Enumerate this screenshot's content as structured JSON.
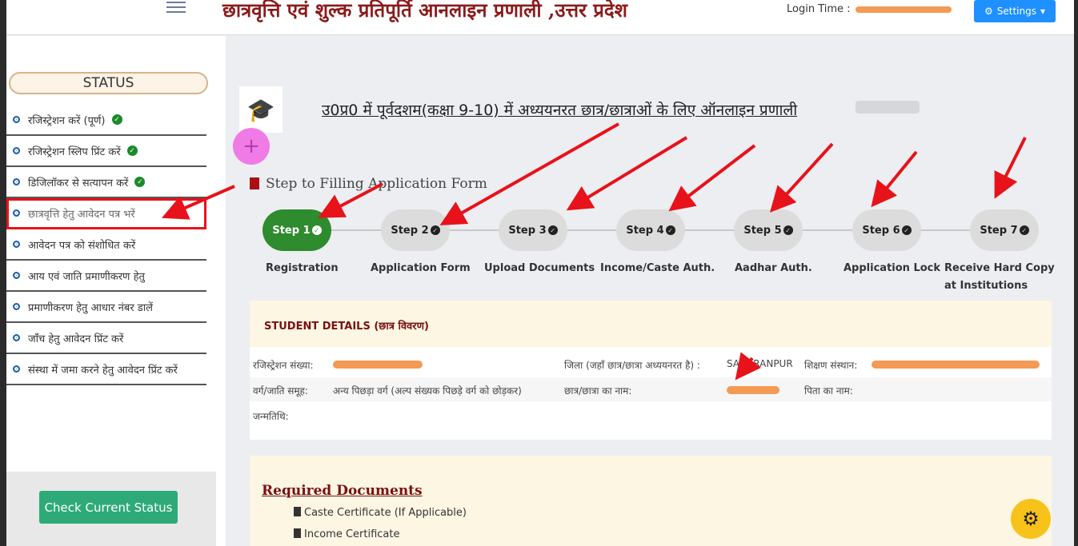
{
  "header": {
    "app_title": "छात्रवृत्ति एवं शुल्क प्रतिपूर्ति आनलाइन प्रणाली ,उत्तर प्रदेश",
    "login_label": "Login Time :",
    "settings_label": "Settings"
  },
  "sidebar": {
    "status_title": "STATUS",
    "items": [
      {
        "label": "रजिस्ट्रेशन करें (पूर्ण)",
        "done": true
      },
      {
        "label": "रजिस्ट्रेशन स्लिप प्रिंट करें",
        "done": true
      },
      {
        "label": "डिजिलॉकर से सत्यापन करें",
        "done": true
      },
      {
        "label": "छात्रवृत्ति हेतु आवेदन पत्र भरें",
        "done": false
      },
      {
        "label": "आवेदन पत्र को संशोधित करें",
        "done": false
      },
      {
        "label": "आय एवं जाति प्रमाणीकरण हेतु",
        "done": false
      },
      {
        "label": "प्रमाणीकरण हेतु आधार नंबर डालें",
        "done": false
      },
      {
        "label": "जाँच हेतु आवेदन प्रिंट करें",
        "done": false
      },
      {
        "label": "संस्था में जमा करने हेतु आवेदन प्रिंट करें",
        "done": false
      }
    ],
    "check_button": "Check Current Status"
  },
  "main": {
    "title": "उ0प्र0 में पूर्वदशम(कक्षा 9-10) में अध्ययनरत छात्र/छात्राओं के लिए ऑनलाइन प्रणाली",
    "step_heading": "Step to Filling Application Form",
    "steps": [
      {
        "badge": "Step 1",
        "label": "Registration",
        "active": true
      },
      {
        "badge": "Step 2",
        "label": "Application Form",
        "active": false
      },
      {
        "badge": "Step 3",
        "label": "Upload Documents",
        "active": false
      },
      {
        "badge": "Step 4",
        "label": "Income/Caste Auth.",
        "active": false
      },
      {
        "badge": "Step 5",
        "label": "Aadhar Auth.",
        "active": false
      },
      {
        "badge": "Step 6",
        "label": "Application Lock",
        "active": false
      },
      {
        "badge": "Step 7",
        "label": "Receive Hard Copy at Institutions",
        "active": false
      }
    ]
  },
  "student_details": {
    "heading": "STUDENT DETAILS (छात्र विवरण)",
    "registration_label": "रजिस्ट्रेशन संख्या:",
    "district_label": "जिला (जहाँ छात्र/छात्रा अध्ययनरत है) :",
    "district_value": "SAHARANPUR",
    "institution_label": "शिक्षण संस्थान:",
    "category_label": "वर्ग/जाति समूह:",
    "category_value": "अन्य पिछड़ा वर्ग (अल्प संख्यक पिछड़े वर्ग को छोड़कर)",
    "student_name_label": "छात्र/छात्रा का नाम:",
    "father_label": "पिता का नाम:",
    "dob_label": "जन्मतिथि:"
  },
  "required_documents": {
    "title": "Required Documents",
    "items": [
      "Caste Certificate (If Applicable)",
      "Income Certificate"
    ]
  },
  "colors": {
    "header_title": "#8b1a1a",
    "active_step": "#2e8b2e",
    "annotation": "#e8121a",
    "check_button": "#2eaa78"
  }
}
